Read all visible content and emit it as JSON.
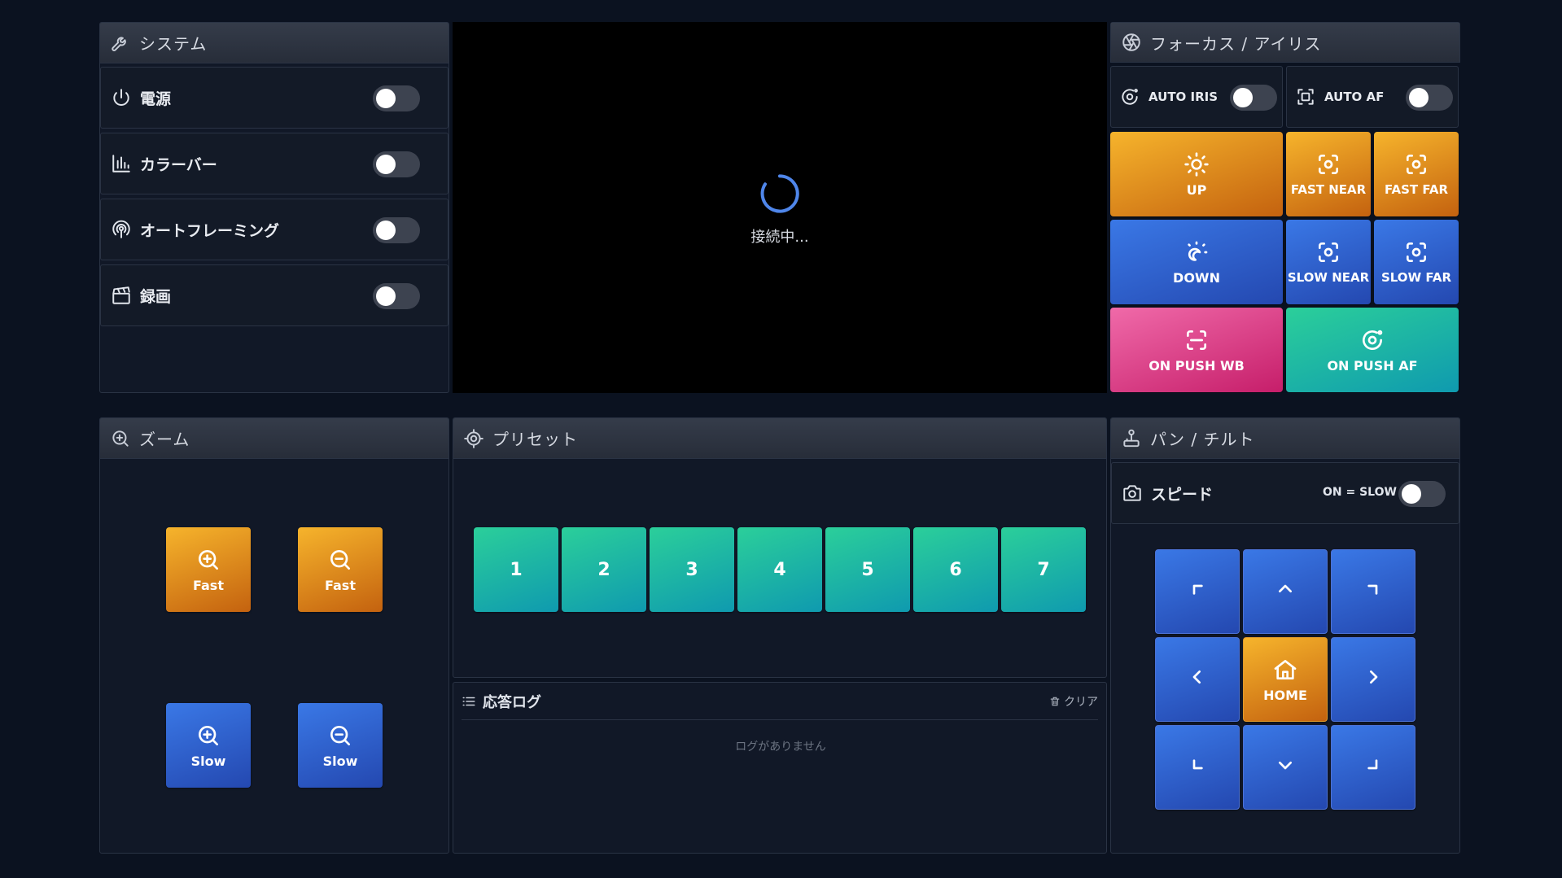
{
  "system": {
    "title": "システム",
    "rows": [
      {
        "label": "電源",
        "on": false
      },
      {
        "label": "カラーバー",
        "on": false
      },
      {
        "label": "オートフレーミング",
        "on": false
      },
      {
        "label": "録画",
        "on": false
      }
    ]
  },
  "video": {
    "status": "接続中..."
  },
  "focus": {
    "title": "フォーカス / アイリス",
    "auto_iris": "AUTO IRIS",
    "auto_af": "AUTO AF",
    "up": "UP",
    "down": "DOWN",
    "fast_near": "FAST NEAR",
    "fast_far": "FAST FAR",
    "slow_near": "SLOW NEAR",
    "slow_far": "SLOW FAR",
    "push_wb": "ON PUSH WB",
    "push_af": "ON PUSH AF"
  },
  "zoom": {
    "title": "ズーム",
    "fast_in": "Fast",
    "fast_out": "Fast",
    "slow_in": "Slow",
    "slow_out": "Slow"
  },
  "preset": {
    "title": "プリセット",
    "items": [
      "1",
      "2",
      "3",
      "4",
      "5",
      "6",
      "7"
    ]
  },
  "log": {
    "title": "応答ログ",
    "clear": "クリア",
    "empty": "ログがありません"
  },
  "pantilt": {
    "title": "パン / チルト",
    "speed_label": "スピード",
    "speed_toggle_label": "ON = SLOW",
    "home": "HOME"
  },
  "colors": {
    "background": "#0b1220",
    "orange": "#f6b42c",
    "blue": "#3a78e6",
    "pink": "#f06aa9",
    "teal": "#2bcf9a",
    "spinner": "#4f86ea"
  }
}
